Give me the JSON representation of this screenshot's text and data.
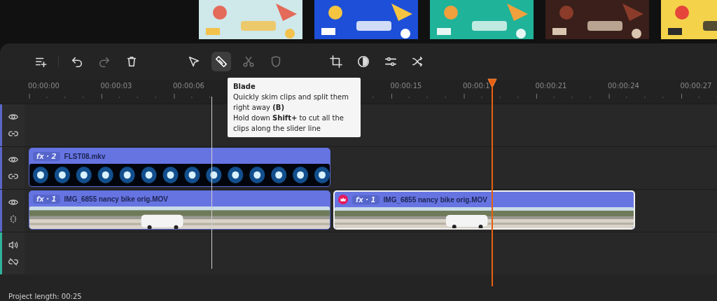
{
  "toolbar": [
    {
      "kind": "add-track",
      "disabled": false,
      "selected": false
    },
    {
      "kind": "undo",
      "disabled": false,
      "selected": false
    },
    {
      "kind": "redo",
      "disabled": true,
      "selected": false
    },
    {
      "kind": "delete",
      "disabled": false,
      "selected": false
    },
    {
      "kind": "select",
      "disabled": false,
      "selected": false
    },
    {
      "kind": "blade",
      "disabled": false,
      "selected": true
    },
    {
      "kind": "scissors",
      "disabled": true,
      "selected": false
    },
    {
      "kind": "shield",
      "disabled": true,
      "selected": false
    },
    {
      "kind": "crop",
      "disabled": false,
      "selected": false
    },
    {
      "kind": "contrast",
      "disabled": false,
      "selected": false
    },
    {
      "kind": "adjust",
      "disabled": false,
      "selected": false
    },
    {
      "kind": "transition",
      "disabled": false,
      "selected": false
    }
  ],
  "ruler": [
    {
      "label": "00:00:00"
    },
    {
      "label": "00:00:03"
    },
    {
      "label": "00:00:06"
    },
    {
      "label": "00:00:15"
    },
    {
      "label": "00:00:1"
    },
    {
      "label": "00:00:21"
    },
    {
      "label": "00:00:24"
    },
    {
      "label": "00:00:27"
    }
  ],
  "tooltip": {
    "title": "Blade",
    "lines": [
      "Quickly skim clips and split them right away **(B)**",
      "Hold down **Shift+** to cut all the clips along the slider line"
    ]
  },
  "tracks": [
    {
      "kind": "video"
    },
    {
      "kind": "video",
      "clips": [
        {
          "kind": "effect",
          "fx": "fx · 2",
          "name": "FLST08.mkv",
          "premium": false,
          "selected": false
        }
      ]
    },
    {
      "kind": "video",
      "clips": [
        {
          "kind": "video",
          "fx": "fx · 1",
          "name": "IMG_6855 nancy bike orig.MOV",
          "premium": false,
          "selected": false
        },
        {
          "kind": "video",
          "fx": "fx · 1",
          "name": "IMG_6855 nancy bike orig.MOV",
          "premium": true,
          "selected": true
        }
      ]
    },
    {
      "kind": "audio"
    }
  ],
  "status": "Project length: 00:25"
}
